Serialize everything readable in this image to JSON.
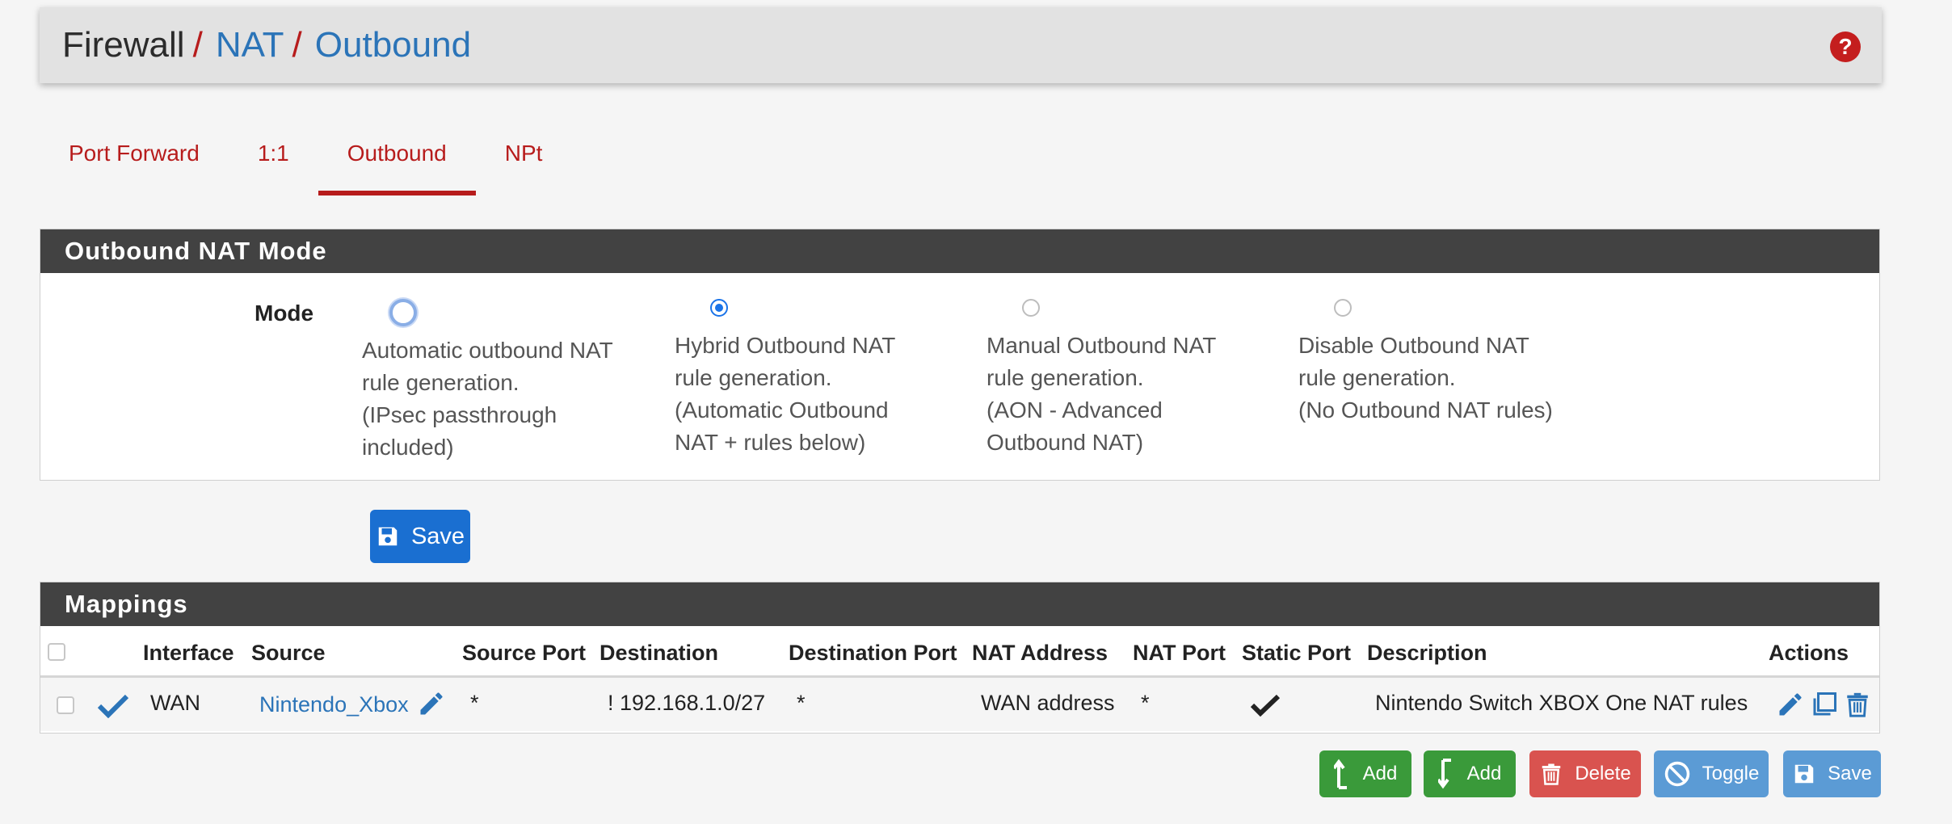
{
  "breadcrumb": {
    "root": "Firewall",
    "sep": "/",
    "level2": "NAT",
    "level3": "Outbound"
  },
  "tabs": [
    {
      "label": "Port Forward",
      "active": false
    },
    {
      "label": "1:1",
      "active": false
    },
    {
      "label": "Outbound",
      "active": true
    },
    {
      "label": "NPt",
      "active": false
    }
  ],
  "mode_panel": {
    "title": "Outbound NAT Mode",
    "label": "Mode",
    "selected": "hybrid",
    "options": [
      {
        "id": "automatic",
        "text": "Automatic outbound NAT\nrule generation.\n(IPsec passthrough\nincluded)"
      },
      {
        "id": "hybrid",
        "text": "Hybrid Outbound NAT\nrule generation.\n(Automatic Outbound\nNAT + rules below)"
      },
      {
        "id": "manual",
        "text": "Manual Outbound NAT\nrule generation.\n(AON - Advanced\nOutbound NAT)"
      },
      {
        "id": "disable",
        "text": "Disable Outbound NAT\nrule generation.\n(No Outbound NAT rules)"
      }
    ],
    "save_label": "Save"
  },
  "mappings": {
    "title": "Mappings",
    "columns": [
      "Interface",
      "Source",
      "Source Port",
      "Destination",
      "Destination Port",
      "NAT Address",
      "NAT Port",
      "Static Port",
      "Description",
      "Actions"
    ],
    "rows": [
      {
        "enabled": true,
        "interface": "WAN",
        "source": "Nintendo_Xbox",
        "source_port": "*",
        "destination": "! 192.168.1.0/27",
        "destination_port": "*",
        "nat_address": "WAN address",
        "nat_port": "*",
        "static_port": true,
        "description": "Nintendo Switch XBOX One NAT rules"
      }
    ]
  },
  "actions": {
    "add_top": "Add",
    "add_bottom": "Add",
    "delete": "Delete",
    "toggle": "Toggle",
    "save": "Save"
  },
  "colors": {
    "accent_red": "#b71c1c",
    "link_blue": "#2b74b8",
    "panel_heading": "#424242",
    "btn_primary": "#1a6fd1",
    "btn_success": "#3a9a3a",
    "btn_danger": "#d9534f",
    "btn_info": "#5b9bd5"
  }
}
